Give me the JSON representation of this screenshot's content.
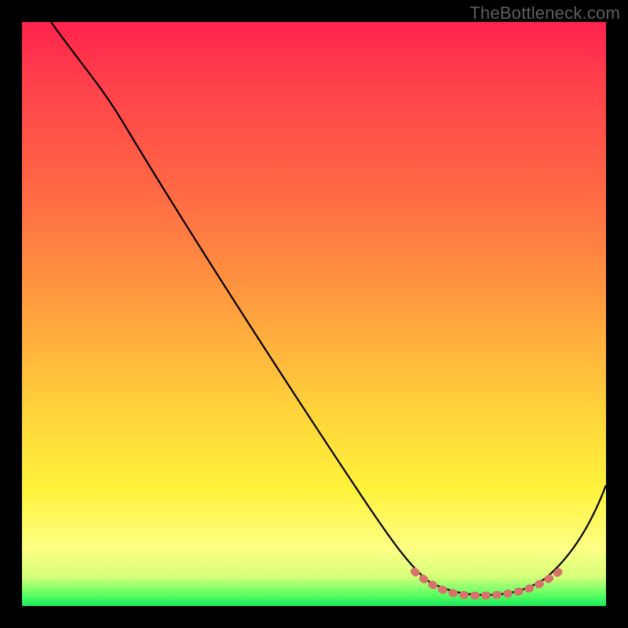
{
  "watermark": "TheBottleneck.com",
  "chart_data": {
    "type": "line",
    "title": "",
    "xlabel": "",
    "ylabel": "",
    "xlim": [
      0,
      100
    ],
    "ylim": [
      0,
      100
    ],
    "x": [
      5,
      15,
      25,
      35,
      45,
      55,
      63,
      68,
      72,
      76,
      80,
      84,
      88,
      92,
      100
    ],
    "values": [
      100,
      88,
      76,
      64,
      52,
      40,
      28,
      18,
      9,
      4.5,
      3.5,
      3.5,
      4.5,
      8,
      25
    ],
    "highlight_region": {
      "x_start": 68,
      "x_end": 92
    },
    "gradient_stops": [
      {
        "pos": 0,
        "color": "#ff234d"
      },
      {
        "pos": 30,
        "color": "#ff6b44"
      },
      {
        "pos": 67,
        "color": "#ffd43a"
      },
      {
        "pos": 90,
        "color": "#feff84"
      },
      {
        "pos": 100,
        "color": "#17e85b"
      }
    ]
  }
}
